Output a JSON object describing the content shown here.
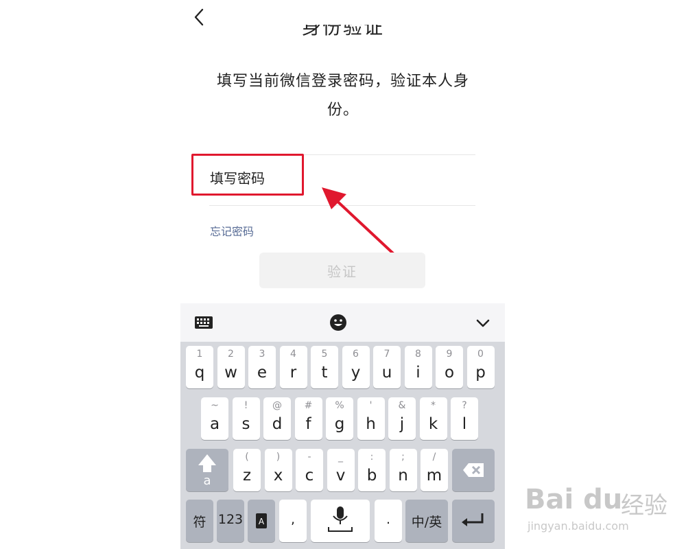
{
  "header": {
    "title_fragment": "身份验证"
  },
  "prompt": {
    "text": "填写当前微信登录密码，验证本人身份。"
  },
  "password": {
    "placeholder": "填写密码",
    "value": ""
  },
  "forgot": {
    "label": "忘记密码"
  },
  "verify": {
    "label": "验证"
  },
  "keyboard": {
    "row1": [
      {
        "sub": "1",
        "main": "q"
      },
      {
        "sub": "2",
        "main": "w"
      },
      {
        "sub": "3",
        "main": "e"
      },
      {
        "sub": "4",
        "main": "r"
      },
      {
        "sub": "5",
        "main": "t"
      },
      {
        "sub": "6",
        "main": "y"
      },
      {
        "sub": "7",
        "main": "u"
      },
      {
        "sub": "8",
        "main": "i"
      },
      {
        "sub": "9",
        "main": "o"
      },
      {
        "sub": "0",
        "main": "p"
      }
    ],
    "row2": [
      {
        "sub": "~",
        "main": "a"
      },
      {
        "sub": "!",
        "main": "s"
      },
      {
        "sub": "@",
        "main": "d"
      },
      {
        "sub": "#",
        "main": "f"
      },
      {
        "sub": "%",
        "main": "g"
      },
      {
        "sub": "'",
        "main": "h"
      },
      {
        "sub": "&",
        "main": "j"
      },
      {
        "sub": "*",
        "main": "k"
      },
      {
        "sub": "?",
        "main": "l"
      }
    ],
    "row3": [
      {
        "sub": "(",
        "main": "z"
      },
      {
        "sub": ")",
        "main": "x"
      },
      {
        "sub": "-",
        "main": "c"
      },
      {
        "sub": "_",
        "main": "v"
      },
      {
        "sub": ":",
        "main": "b"
      },
      {
        "sub": ";",
        "main": "n"
      },
      {
        "sub": "/",
        "main": "m"
      }
    ],
    "shift_label": "a",
    "symbols_label": "符",
    "numbers_label": "123",
    "comma_label": ",",
    "period_label": ".",
    "lang_label": "中/英"
  },
  "watermark": {
    "brand": "Bai du",
    "cn": "经验",
    "url": "jingyan.baidu.com"
  },
  "colors": {
    "highlight": "#e0182e",
    "link": "#576b95"
  }
}
